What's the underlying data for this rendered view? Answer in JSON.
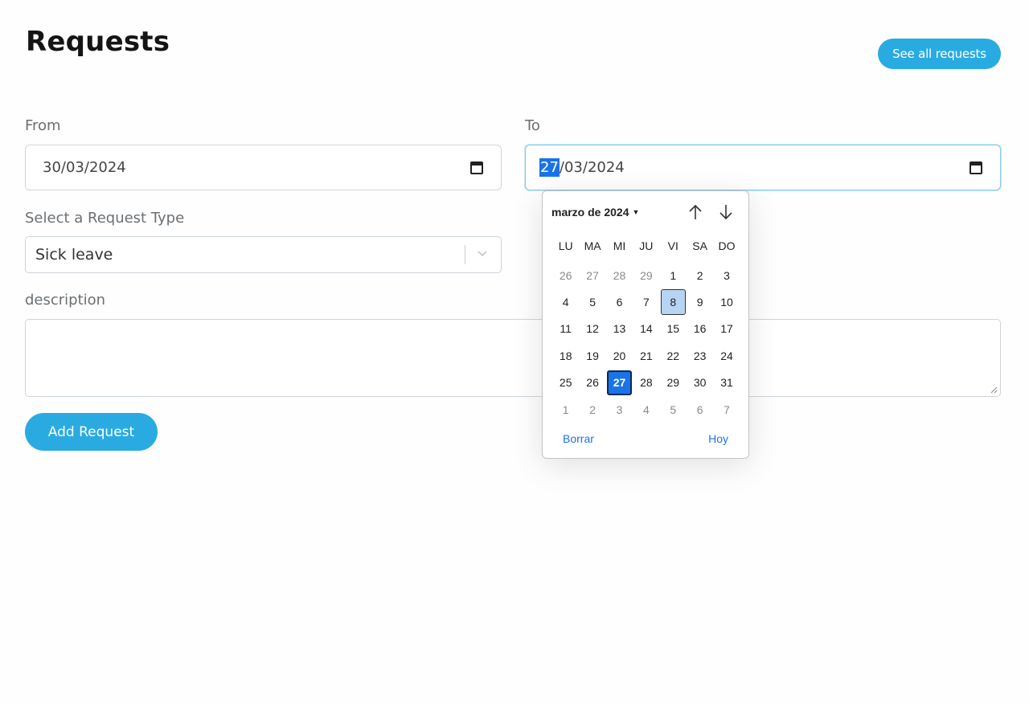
{
  "header": {
    "title": "Requests",
    "see_all_label": "See all requests"
  },
  "form": {
    "from_label": "From",
    "from_value": "30/03/2024",
    "to_label": "To",
    "to_day": "27",
    "to_rest": "/03/2024",
    "type_label": "Select a Request Type",
    "type_value": "Sick leave",
    "description_label": "description",
    "description_value": "",
    "add_label": "Add Request"
  },
  "picker": {
    "month_label": "marzo de 2024",
    "weekdays": [
      "LU",
      "MA",
      "MI",
      "JU",
      "VI",
      "SA",
      "DO"
    ],
    "days": [
      {
        "d": "26",
        "muted": true
      },
      {
        "d": "27",
        "muted": true
      },
      {
        "d": "28",
        "muted": true
      },
      {
        "d": "29",
        "muted": true
      },
      {
        "d": "1"
      },
      {
        "d": "2"
      },
      {
        "d": "3"
      },
      {
        "d": "4"
      },
      {
        "d": "5"
      },
      {
        "d": "6"
      },
      {
        "d": "7"
      },
      {
        "d": "8",
        "state": "hl"
      },
      {
        "d": "9"
      },
      {
        "d": "10"
      },
      {
        "d": "11"
      },
      {
        "d": "12"
      },
      {
        "d": "13"
      },
      {
        "d": "14"
      },
      {
        "d": "15"
      },
      {
        "d": "16"
      },
      {
        "d": "17"
      },
      {
        "d": "18"
      },
      {
        "d": "19"
      },
      {
        "d": "20"
      },
      {
        "d": "21"
      },
      {
        "d": "22"
      },
      {
        "d": "23"
      },
      {
        "d": "24"
      },
      {
        "d": "25"
      },
      {
        "d": "26"
      },
      {
        "d": "27",
        "state": "sel"
      },
      {
        "d": "28"
      },
      {
        "d": "29"
      },
      {
        "d": "30"
      },
      {
        "d": "31"
      },
      {
        "d": "1",
        "muted": true
      },
      {
        "d": "2",
        "muted": true
      },
      {
        "d": "3",
        "muted": true
      },
      {
        "d": "4",
        "muted": true
      },
      {
        "d": "5",
        "muted": true
      },
      {
        "d": "6",
        "muted": true
      },
      {
        "d": "7",
        "muted": true
      }
    ],
    "clear_label": "Borrar",
    "today_label": "Hoy"
  },
  "icons": {
    "calendar": "calendar-icon",
    "chevron": "chevron-down-icon",
    "up": "arrow-up-icon",
    "down": "arrow-down-icon"
  },
  "colors": {
    "accent": "#29abe2",
    "selected_day": "#1a73e8",
    "highlight_day": "#b8d4f5"
  }
}
